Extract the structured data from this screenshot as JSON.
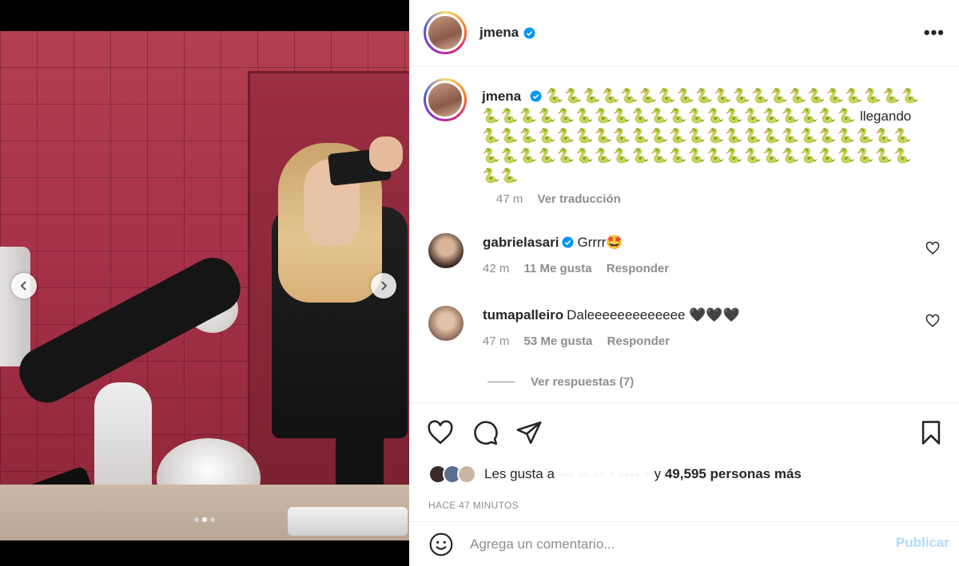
{
  "post": {
    "username": "jmena",
    "caption_before": "🐍🐍🐍🐍🐍🐍🐍🐍🐍🐍🐍🐍🐍🐍🐍🐍🐍🐍🐍🐍🐍🐍🐍🐍🐍🐍🐍🐍🐍🐍🐍🐍🐍🐍🐍🐍🐍🐍🐍🐍",
    "caption_word": "llegando",
    "caption_after": "🐍🐍🐍🐍🐍🐍🐍🐍🐍🐍🐍🐍🐍🐍🐍🐍🐍🐍🐍🐍🐍🐍🐍🐍🐍🐍🐍🐍🐍🐍🐍🐍🐍🐍🐍🐍🐍🐍🐍🐍🐍🐍🐍🐍🐍🐍🐍🐍",
    "time": "47 m",
    "translate": "Ver traducción"
  },
  "comments": [
    {
      "username": "gabrielasari",
      "text": "Grrrr🤩",
      "time": "42 m",
      "likes": "11 Me gusta",
      "reply": "Responder"
    },
    {
      "username": "tumapalleiro",
      "text": "Daleeeeeeeeeeeee 🖤🖤🖤",
      "time": "47 m",
      "likes": "53 Me gusta",
      "reply": "Responder"
    }
  ],
  "replies_label": "Ver respuestas (7)",
  "likes": {
    "prefix": "Les gusta a",
    "hidden_name": "··· ·· ·· · ···· ·",
    "middle": " y ",
    "count": "49,595 personas más"
  },
  "posted_ago": "HACE 47 MINUTOS",
  "comment_box": {
    "placeholder": "Agrega un comentario...",
    "post_label": "Publicar"
  },
  "carousel": {
    "slides": 3,
    "active": 1
  },
  "colors": {
    "verified": "#0095f6",
    "muted": "#8e8e8e",
    "publish_disabled": "#b3dbff",
    "snake_emoji": "#6f9e1a"
  }
}
